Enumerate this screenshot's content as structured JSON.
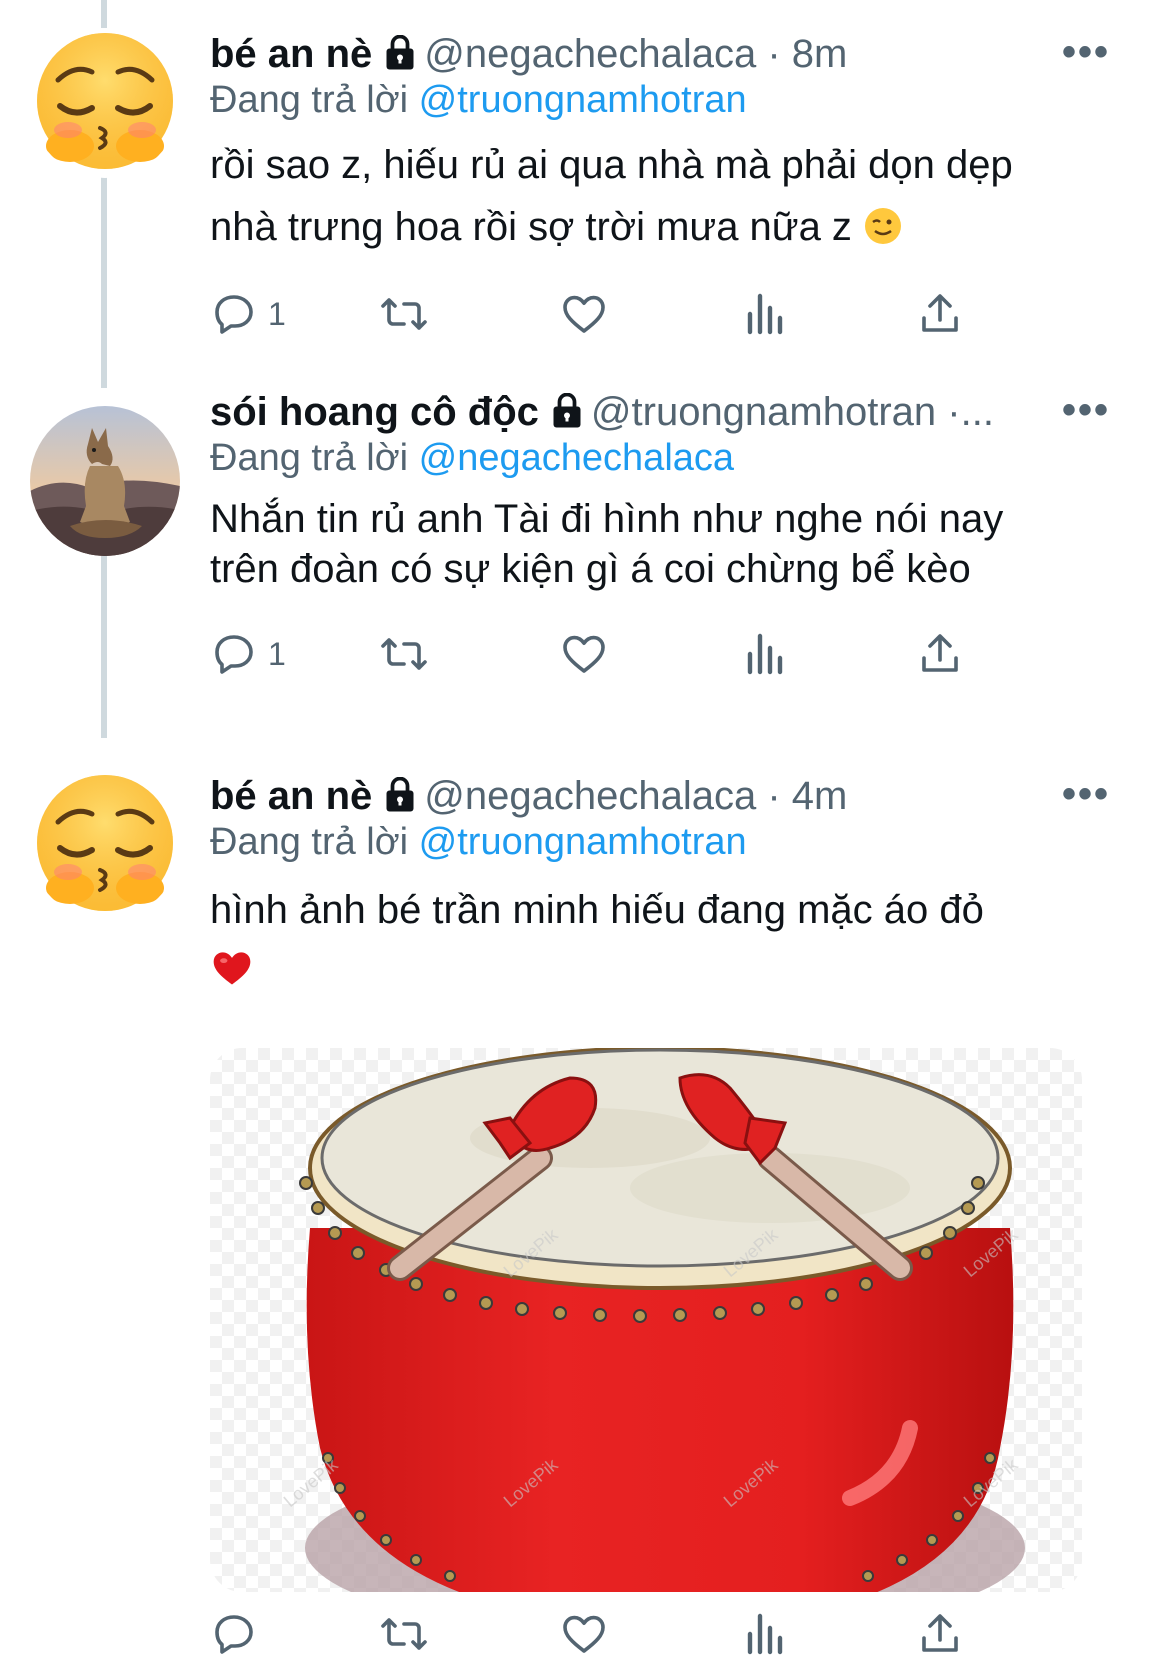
{
  "tweets": [
    {
      "name": "bé an nè",
      "handle": "@negachechalaca",
      "time": "8m",
      "separator": "·",
      "replying_label": "Đang trả lời",
      "replying_to": "@truongnamhotran",
      "text_line1": "rồi sao z, hiếu rủ ai qua nhà mà phải dọn dẹp",
      "text_line2": "nhà trưng hoa rồi sợ trời mưa nữa z",
      "text_emoji": "winking-face-emoji",
      "avatar": "pleading-face-emoji-avatar",
      "reply_count": "1"
    },
    {
      "name": "sói hoang cô độc",
      "handle": "@truongnamhotran",
      "time_truncated": "·...",
      "replying_label": "Đang trả lời",
      "replying_to": "@negachechalaca",
      "text_line1": "Nhắn tin rủ anh Tài đi hình như nghe nói nay",
      "text_line2": "trên đoàn có sự kiện gì á coi chừng bể kèo",
      "avatar": "meditating-wolf-avatar",
      "reply_count": "1"
    },
    {
      "name": "bé an nè",
      "handle": "@negachechalaca",
      "time": "4m",
      "separator": "·",
      "replying_label": "Đang trả lời",
      "replying_to": "@truongnamhotran",
      "text_line1": "hình ảnh bé trần minh hiếu đang mặc áo đỏ",
      "text_emoji": "red-heart-emoji",
      "avatar": "pleading-face-emoji-avatar",
      "media": "red-drum-illustration",
      "watermark": "LovePik"
    }
  ],
  "more_label": "•••",
  "icons": [
    "reply-icon",
    "retweet-icon",
    "like-icon",
    "analytics-icon",
    "share-icon"
  ],
  "colors": {
    "link": "#1d9bf0",
    "secondary": "#536471",
    "thread_line": "#cfd9de",
    "drum_red": "#e02222"
  }
}
